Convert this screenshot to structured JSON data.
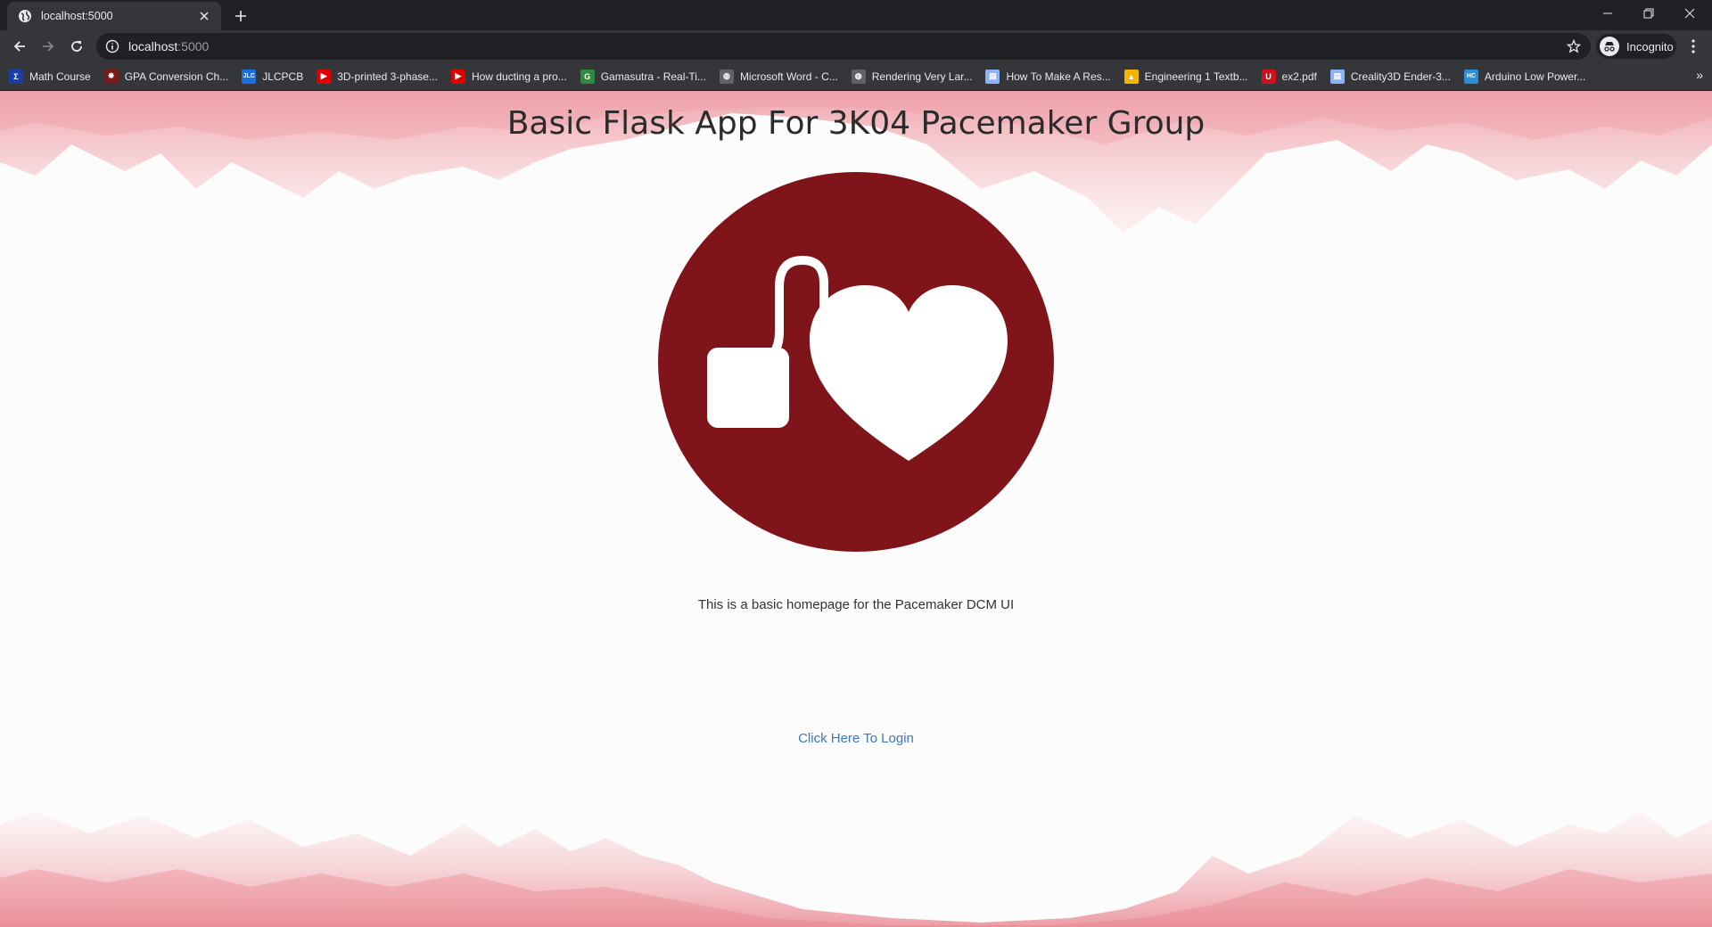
{
  "browser": {
    "tab": {
      "title": "localhost:5000"
    },
    "address": {
      "host": "localhost",
      "port": ":5000"
    },
    "profile_label": "Incognito",
    "bookmarks": [
      {
        "label": "Math Course",
        "icon": "sigma-icon",
        "color": "#1a3ea8"
      },
      {
        "label": "GPA Conversion Ch...",
        "icon": "crest-icon",
        "color": "#7a1a1a"
      },
      {
        "label": "JLCPCB",
        "icon": "jlc-icon",
        "color": "#1d6fe0"
      },
      {
        "label": "3D-printed 3-phase...",
        "icon": "youtube-icon",
        "color": "#e00000"
      },
      {
        "label": "How ducting a pro...",
        "icon": "youtube-icon",
        "color": "#e00000"
      },
      {
        "label": "Gamasutra - Real-Ti...",
        "icon": "gamasutra-icon",
        "color": "#2d8a3e"
      },
      {
        "label": "Microsoft Word - C...",
        "icon": "globe-icon",
        "color": "#5f6368"
      },
      {
        "label": "Rendering Very Lar...",
        "icon": "globe-icon",
        "color": "#5f6368"
      },
      {
        "label": "How To Make A Res...",
        "icon": "page-icon",
        "color": "#8ab4f8"
      },
      {
        "label": "Engineering 1 Textb...",
        "icon": "drive-icon",
        "color": "#f4b400"
      },
      {
        "label": "ex2.pdf",
        "icon": "shield-u-icon",
        "color": "#d10f1d"
      },
      {
        "label": "Creality3D Ender-3...",
        "icon": "page-icon",
        "color": "#8ab4f8"
      },
      {
        "label": "Arduino Low Power...",
        "icon": "hc-icon",
        "color": "#2b8fd6"
      }
    ]
  },
  "page": {
    "title": "Basic Flask App For 3K04 Pacemaker Group",
    "description": "This is a basic homepage for the Pacemaker DCM UI",
    "login_link": "Click Here To Login",
    "logo_icon": "pacemaker-heart-icon",
    "colors": {
      "logo": "#7f151a",
      "link": "#3a77c2",
      "wash": "#e8707a"
    }
  }
}
